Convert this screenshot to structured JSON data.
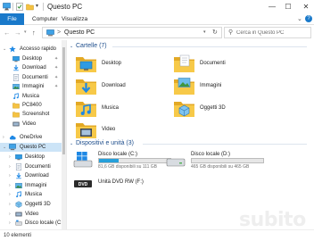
{
  "window": {
    "title": "Questo PC",
    "quick_access_dropdown": "▾",
    "controls": {
      "minimize": "—",
      "maximize": "☐",
      "close": "✕"
    }
  },
  "ribbon": {
    "tabs": [
      "File",
      "Computer",
      "Visualizza"
    ],
    "collapse": "⌄",
    "help": "?"
  },
  "address": {
    "back": "←",
    "forward": "→",
    "history": "▾",
    "up": "↑",
    "separator": ">",
    "path": "Questo PC",
    "dropdown": "▾",
    "refresh": "↻"
  },
  "search": {
    "icon": "⚲",
    "placeholder": "Cerca in Questo PC"
  },
  "nav_pane": {
    "quick_access": {
      "label": "Accesso rapido",
      "icon": "star-icon",
      "icon_color": "#1e88e5"
    },
    "pinned": [
      {
        "label": "Desktop",
        "icon": "desktop-folder-icon",
        "pin": "✦"
      },
      {
        "label": "Download",
        "icon": "download-folder-icon",
        "pin": "✦"
      },
      {
        "label": "Documenti",
        "icon": "documents-folder-icon",
        "pin": "✦"
      },
      {
        "label": "Immagini",
        "icon": "pictures-folder-icon",
        "pin": "✦"
      },
      {
        "label": "Musica",
        "icon": "music-folder-icon",
        "pin": ""
      },
      {
        "label": "PC8400",
        "icon": "folder-icon",
        "pin": ""
      },
      {
        "label": "Screenshot",
        "icon": "folder-icon",
        "pin": ""
      },
      {
        "label": "Video",
        "icon": "video-folder-icon",
        "pin": ""
      }
    ],
    "onedrive": {
      "label": "OneDrive",
      "icon": "cloud-icon"
    },
    "this_pc": {
      "label": "Questo PC",
      "icon": "computer-icon"
    },
    "pc_children": [
      {
        "label": "Desktop",
        "icon": "desktop-folder-icon"
      },
      {
        "label": "Documenti",
        "icon": "documents-folder-icon"
      },
      {
        "label": "Download",
        "icon": "download-folder-icon"
      },
      {
        "label": "Immagini",
        "icon": "pictures-folder-icon"
      },
      {
        "label": "Musica",
        "icon": "music-folder-icon"
      },
      {
        "label": "Oggetti 3D",
        "icon": "3d-objects-folder-icon"
      },
      {
        "label": "Video",
        "icon": "video-folder-icon"
      },
      {
        "label": "Disco locale (C:)",
        "icon": "drive-icon"
      }
    ],
    "chevron_collapsed": "›",
    "chevron_expanded": "⌄"
  },
  "content": {
    "folders_header": "Cartelle (7)",
    "folders": [
      {
        "label": "Desktop",
        "icon": "desktop-folder-icon"
      },
      {
        "label": "Documenti",
        "icon": "documents-folder-icon"
      },
      {
        "label": "Download",
        "icon": "download-folder-icon"
      },
      {
        "label": "Immagini",
        "icon": "pictures-folder-icon"
      },
      {
        "label": "Musica",
        "icon": "music-folder-icon"
      },
      {
        "label": "Oggetti 3D",
        "icon": "3d-objects-folder-icon"
      },
      {
        "label": "Video",
        "icon": "video-folder-icon"
      }
    ],
    "devices_header": "Dispositivi e unità (3)",
    "drives": [
      {
        "name": "Disco locale (C:)",
        "free": "81,6 GB disponibili su 111 GB",
        "used_fraction": 0.27,
        "icon": "windows-drive-icon"
      },
      {
        "name": "Disco locale (D:)",
        "free": "465 GB disponibili su 465 GB",
        "used_fraction": 0.0,
        "icon": "hard-drive-icon"
      },
      {
        "name": "Unità DVD RW (F:)",
        "icon": "dvd-drive-icon"
      }
    ]
  },
  "status": {
    "count": "10 elementi"
  },
  "watermark": "subito",
  "colors": {
    "accent": "#1979ca",
    "selection": "#cce4f7",
    "folder": "#f5c242",
    "bar_fill": "#26a0da",
    "header_text": "#1e4e8c"
  }
}
